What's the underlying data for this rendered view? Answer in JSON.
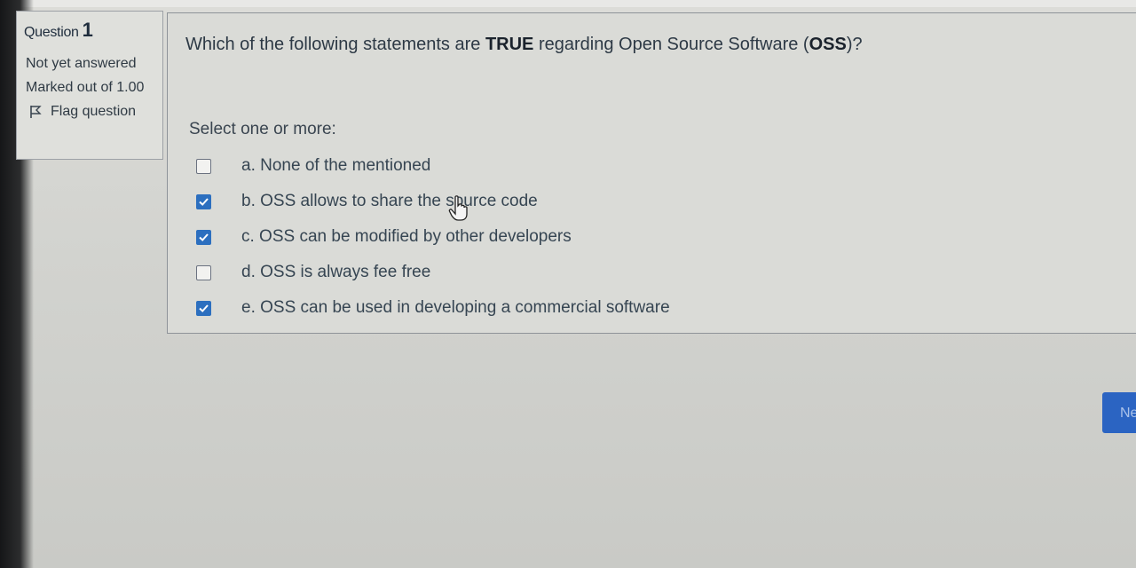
{
  "question_info": {
    "heading": "Question",
    "number": "1",
    "state": "Not yet answered",
    "grade": "Marked out of 1.00",
    "flag_label": "Flag question",
    "flag_icon": "flag-icon"
  },
  "question": {
    "text_before": "Which of the following statements are ",
    "text_bold": "TRUE",
    "text_middle": " regarding Open Source Software (",
    "text_bold2": "OSS",
    "text_after": ")?",
    "prompt": "Select one or more:",
    "options": [
      {
        "label": "a. None of the mentioned",
        "checked": false
      },
      {
        "label": "b. OSS allows to share the source code",
        "checked": true
      },
      {
        "label": "c. OSS can be modified by other developers",
        "checked": true
      },
      {
        "label": "d. OSS is always fee free",
        "checked": false
      },
      {
        "label": "e. OSS can be used in developing a commercial software",
        "checked": true
      }
    ]
  },
  "navigation": {
    "next_label": "Ne"
  },
  "colors": {
    "checkbox_checked": "#2c6fbf",
    "next_button": "#2b64c2"
  }
}
